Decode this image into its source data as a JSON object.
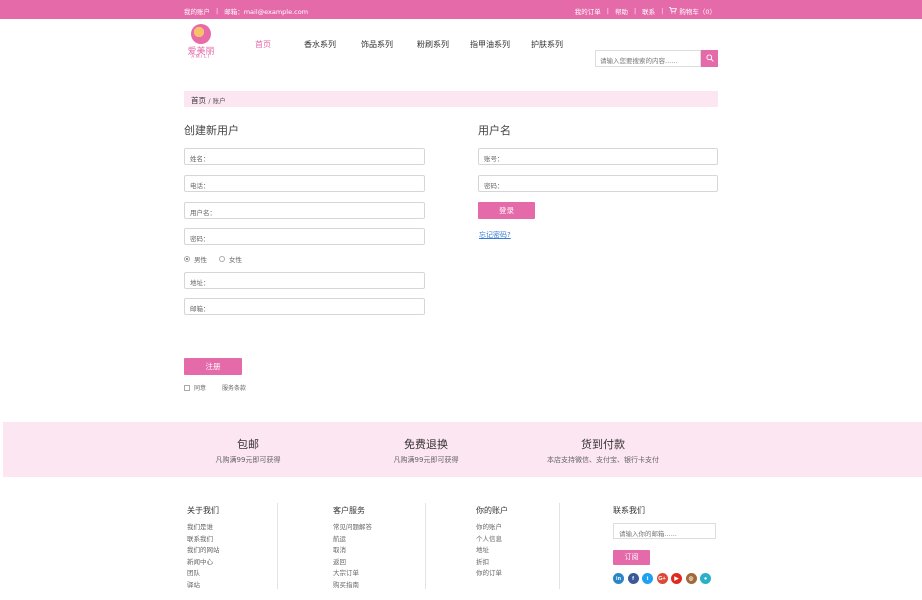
{
  "topbar": {
    "my_account": "我的账户",
    "email_label": "邮箱：mail@example.com",
    "my_orders": "我的订单",
    "help": "帮助",
    "contact": "联系",
    "cart": "购物车（0）",
    "cart_icon": "cart-icon"
  },
  "logo": {
    "cn": "爱美丽",
    "en": "AMILI"
  },
  "nav": {
    "items": [
      {
        "label": "首页",
        "active": true
      },
      {
        "label": "香水系列"
      },
      {
        "label": "饰品系列"
      },
      {
        "label": "粉刷系列"
      },
      {
        "label": "指甲油系列"
      },
      {
        "label": "护肤系列"
      }
    ]
  },
  "search": {
    "placeholder": "请输入您要搜索的内容......",
    "icon": "search-icon"
  },
  "breadcrumb": {
    "home": "首页",
    "current": "/ 账户"
  },
  "register": {
    "title": "创建新用户",
    "fields": [
      "姓名：",
      "电话：",
      "用户名：",
      "密码：",
      "地址：",
      "邮箱："
    ],
    "gender_male": "男性",
    "gender_female": "女性",
    "submit": "注册",
    "agree": "同意",
    "terms": "服务条款"
  },
  "login": {
    "title": "用户名",
    "fields": [
      "账号：",
      "密码："
    ],
    "submit": "登录",
    "forgot": "忘记密码?"
  },
  "features": [
    {
      "title": "包邮",
      "sub": "凡购满99元即可获得"
    },
    {
      "title": "免费退换",
      "sub": "凡购满99元即可获得"
    },
    {
      "title": "货到付款",
      "sub": "本店支持微信、支付宝、银行卡支付"
    }
  ],
  "footer": {
    "about": {
      "title": "关于我们",
      "items": [
        "我们是谁",
        "联系我们",
        "我们的网站",
        "新闻中心",
        "团队",
        "驿站"
      ]
    },
    "service": {
      "title": "客户服务",
      "items": [
        "常见问题解答",
        "航运",
        "取消",
        "返回",
        "大宗订单",
        "购买指南"
      ]
    },
    "account": {
      "title": "你的账户",
      "items": [
        "你的账户",
        "个人信息",
        "地址",
        "折扣",
        "你的订单"
      ]
    },
    "contact": {
      "title": "联系我们",
      "email_placeholder": "请输入你的邮箱......",
      "subscribe": "订阅",
      "social": [
        {
          "icon": "linkedin-icon",
          "glyph": "in",
          "color": "#2a84c8"
        },
        {
          "icon": "facebook-icon",
          "glyph": "f",
          "color": "#3b5998"
        },
        {
          "icon": "twitter-icon",
          "glyph": "t",
          "color": "#1da1f2"
        },
        {
          "icon": "google-plus-icon",
          "glyph": "G+",
          "color": "#dc4a38"
        },
        {
          "icon": "youtube-icon",
          "glyph": "▶",
          "color": "#e02a20"
        },
        {
          "icon": "instagram-icon",
          "glyph": "◎",
          "color": "#a0693a"
        },
        {
          "icon": "location-icon",
          "glyph": "●",
          "color": "#2ab0c8"
        }
      ]
    }
  }
}
